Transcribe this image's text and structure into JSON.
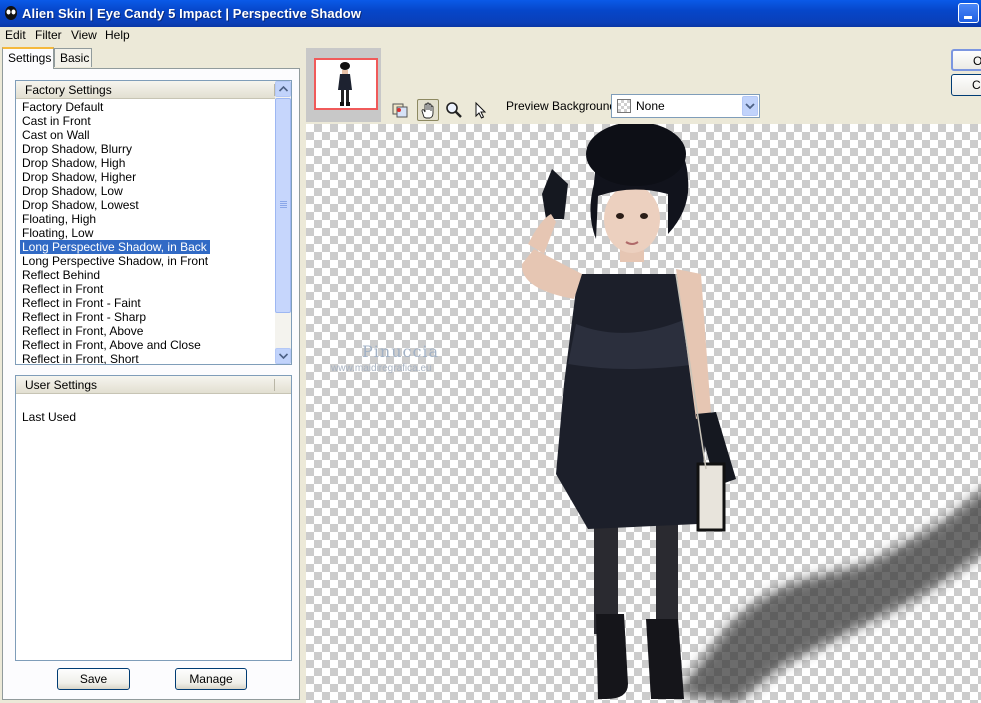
{
  "window": {
    "title": "Alien Skin | Eye Candy 5 Impact | Perspective Shadow"
  },
  "menu": [
    "Edit",
    "Filter",
    "View",
    "Help"
  ],
  "tabs": [
    {
      "label": "Settings",
      "active": true
    },
    {
      "label": "Basic",
      "active": false
    }
  ],
  "factory_settings": {
    "header": "Factory Settings",
    "items": [
      "Factory Default",
      "Cast in Front",
      "Cast on Wall",
      "Drop Shadow, Blurry",
      "Drop Shadow, High",
      "Drop Shadow, Higher",
      "Drop Shadow, Low",
      "Drop Shadow, Lowest",
      "Floating, High",
      "Floating, Low",
      "Long Perspective Shadow, in Back",
      "Long Perspective Shadow, in Front",
      "Reflect Behind",
      "Reflect in Front",
      "Reflect in Front - Faint",
      "Reflect in Front - Sharp",
      "Reflect in Front, Above",
      "Reflect in Front, Above and Close",
      "Reflect in Front, Short"
    ],
    "selected": "Long Perspective Shadow, in Back"
  },
  "user_settings": {
    "header": "User Settings",
    "items": [
      "Last Used"
    ]
  },
  "buttons": {
    "save": "Save",
    "manage": "Manage",
    "ok": "OK",
    "cancel": "Cancel"
  },
  "toolbar": {
    "icons": [
      "preview-compare-icon",
      "hand-pan-icon",
      "zoom-icon",
      "arrow-pointer-icon"
    ],
    "active": "hand-pan-icon"
  },
  "preview_background": {
    "label": "Preview Background:",
    "value": "None"
  },
  "watermark": {
    "title": "Pinuccia",
    "subtitle": "www.maidiregrafica.eu"
  },
  "colors": {
    "titlebar": "#0a4fd6",
    "selection": "#316ac5",
    "window_bg": "#ece9d8",
    "thumbnail_frame": "#f05a5a"
  }
}
